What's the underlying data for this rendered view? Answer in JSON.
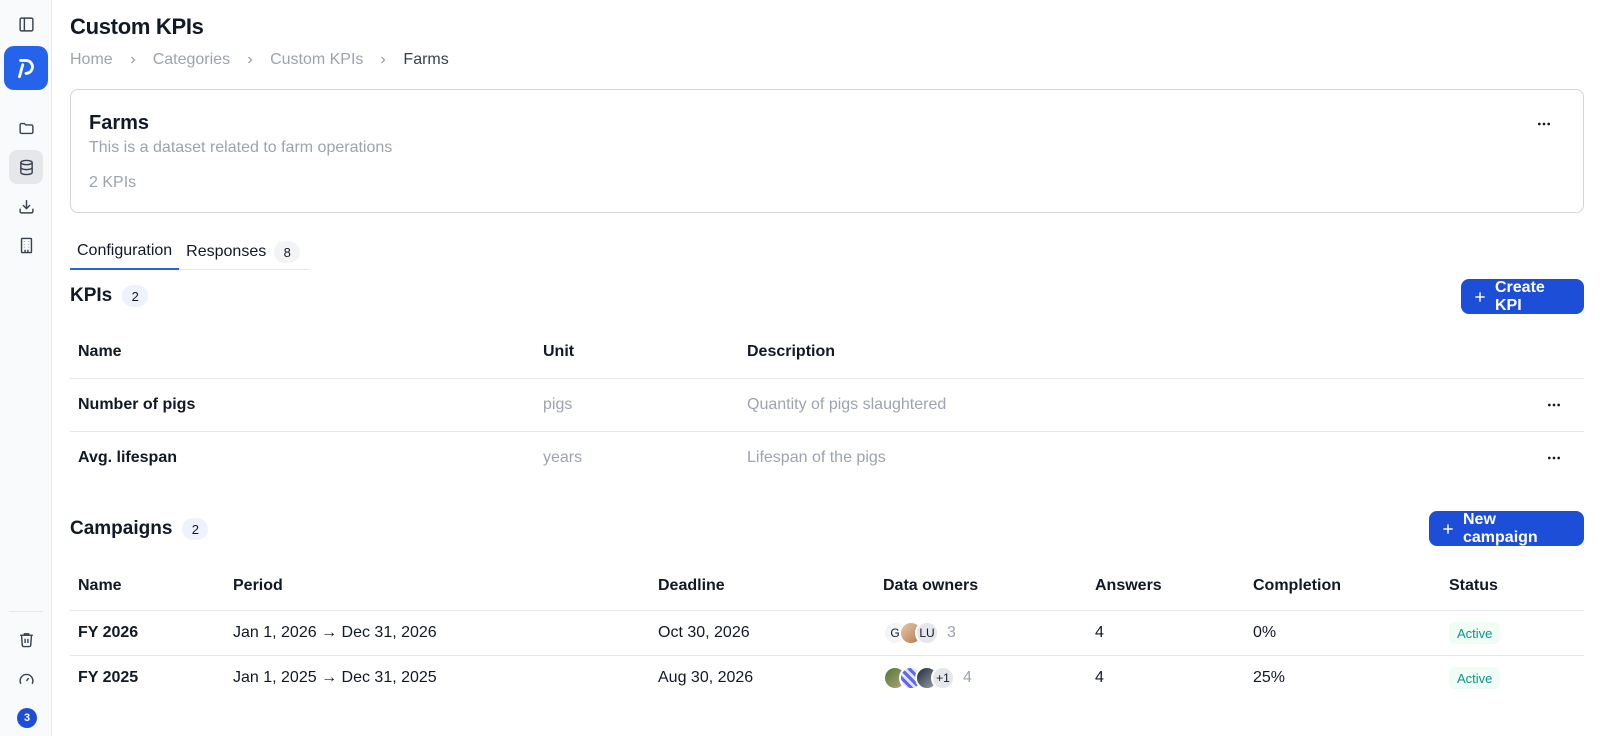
{
  "sidebar": {
    "notification_count": "3",
    "icons": [
      "panel-toggle-icon",
      "folder-icon",
      "database-icon",
      "download-icon",
      "building-icon",
      "trash-icon",
      "gauge-icon"
    ]
  },
  "page": {
    "title": "Custom KPIs",
    "breadcrumb": [
      "Home",
      "Categories",
      "Custom KPIs",
      "Farms"
    ]
  },
  "dataset": {
    "name": "Farms",
    "description": "This is a dataset related to farm operations",
    "kpi_count": "2 KPIs"
  },
  "tabs": [
    {
      "label": "Configuration",
      "active": true
    },
    {
      "label": "Responses",
      "count": "8"
    }
  ],
  "kpis": {
    "title": "KPIs",
    "count": "2",
    "create_label": "Create KPI",
    "columns": [
      "Name",
      "Unit",
      "Description"
    ],
    "rows": [
      {
        "name": "Number of pigs",
        "unit": "pigs",
        "description": "Quantity of pigs slaughtered"
      },
      {
        "name": "Avg. lifespan",
        "unit": "years",
        "description": "Lifespan of the pigs"
      }
    ]
  },
  "campaigns": {
    "title": "Campaigns",
    "count": "2",
    "new_label": "New campaign",
    "columns": [
      "Name",
      "Period",
      "Deadline",
      "Data owners",
      "Answers",
      "Completion",
      "Status"
    ],
    "rows": [
      {
        "name": "FY 2026",
        "period": "Jan 1, 2026 → Dec 31, 2026",
        "deadline": "Oct 30, 2026",
        "owners": [
          "G",
          "",
          "LU"
        ],
        "owners_count": "3",
        "answers": "4",
        "completion": "0%",
        "status": "Active"
      },
      {
        "name": "FY 2025",
        "period": "Jan 1, 2025 → Dec 31, 2025",
        "deadline": "Aug 30, 2026",
        "owners": [
          "",
          "",
          "",
          "+1"
        ],
        "owners_count": "4",
        "answers": "4",
        "completion": "25%",
        "status": "Active"
      }
    ]
  },
  "colors": {
    "accent": "#1d4ed8",
    "status_active_text": "#0d9488",
    "status_active_bg": "#f0fdf4"
  }
}
